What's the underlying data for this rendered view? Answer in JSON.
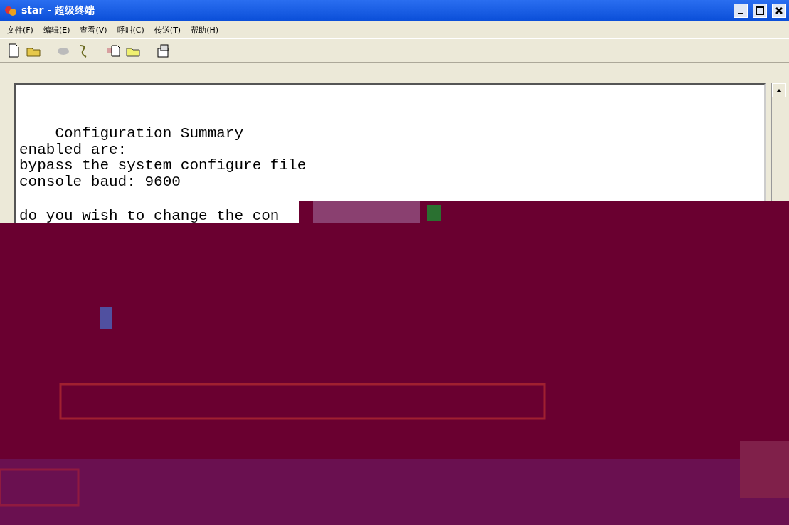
{
  "window": {
    "title": "star - 超级终端"
  },
  "menu": [
    "文件(F)",
    "编辑(E)",
    "查看(V)",
    "呼叫(C)",
    "传送(T)",
    "帮助(H)"
  ],
  "terminal": {
    "summary_lines": [
      "    Configuration Summary",
      "enabled are:",
      "bypass the system configure file",
      "console baud: 9600"
    ],
    "prompt_line": "do you wish to change the con"
  }
}
